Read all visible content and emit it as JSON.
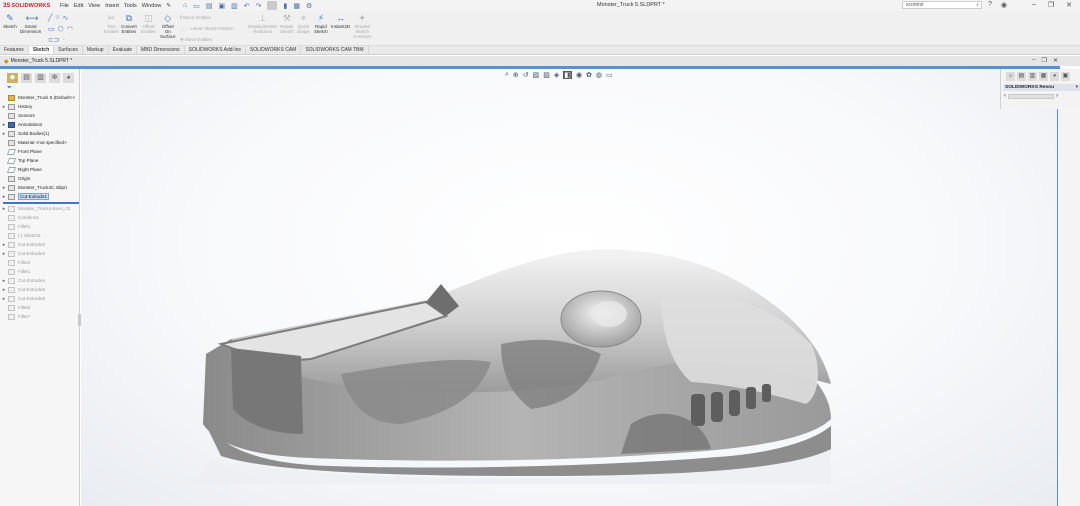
{
  "app": {
    "brand_ds": "3S",
    "brand_name": "SOLIDWORKS",
    "menus": [
      "File",
      "Edit",
      "View",
      "Insert",
      "Tools",
      "Window"
    ],
    "doc_title": "Monster_Truck 5.SLDPRT *",
    "search_placeholder": "xcontrol",
    "brand_color": "#d71920",
    "accent_color": "#5a8fd0"
  },
  "commands": {
    "sketch": "Sketch",
    "smart_dimension": [
      "Smart",
      "Dimension"
    ],
    "trim_entities": [
      "Trim",
      "Entities"
    ],
    "convert_entities": [
      "Convert",
      "Entities"
    ],
    "offset_entities": [
      "Offset",
      "Entities"
    ],
    "offset_on_surface": [
      "Offset",
      "On",
      "Surface"
    ],
    "mirror_entities": "Mirror Entities",
    "linear_sketch_pattern": "Linear Sketch Pattern",
    "move_entities": "Move Entities",
    "display_delete": [
      "Display/Delete",
      "Relations"
    ],
    "repair_sketch": [
      "Repair",
      "Sketch"
    ],
    "quick_snaps": [
      "Quick",
      "Snaps"
    ],
    "rapid_sketch": [
      "Rapid",
      "Sketch"
    ],
    "instant2d": "Instant2D",
    "shaded_sketch": [
      "Shaded",
      "Sketch",
      "Contours"
    ]
  },
  "tabs": [
    "Features",
    "Sketch",
    "Surfaces",
    "Markup",
    "Evaluate",
    "MBD Dimensions",
    "SOLIDWORKS Add-Ins",
    "SOLIDWORKS CAM",
    "SOLIDWORKS CAM TBM"
  ],
  "active_tab": "Sketch",
  "feature_tree": {
    "root": "Monster_Truck 5 (Default<<",
    "items": [
      {
        "label": "History",
        "expand": "▸",
        "kind": "folder"
      },
      {
        "label": "Sensors",
        "expand": "",
        "kind": "folder"
      },
      {
        "label": "Annotations",
        "expand": "▸",
        "kind": "ann"
      },
      {
        "label": "Solid Bodies(1)",
        "expand": "▸",
        "kind": "folder"
      },
      {
        "label": "Material <not specified>",
        "expand": "",
        "kind": "folder"
      },
      {
        "label": "Front Plane",
        "expand": "",
        "kind": "plane"
      },
      {
        "label": "Top Plane",
        "expand": "",
        "kind": "plane"
      },
      {
        "label": "Right Plane",
        "expand": "",
        "kind": "plane"
      },
      {
        "label": "Origin",
        "expand": "",
        "kind": "origin"
      },
      {
        "label": "Monster_Truck4C.sldprt",
        "expand": "▸",
        "kind": "folder"
      },
      {
        "label": "Cut-Extrude1",
        "expand": "▸",
        "kind": "sel"
      }
    ],
    "rolled_back": [
      {
        "label": "Monster_Truck4-Boss_Ot",
        "expand": "▸"
      },
      {
        "label": "Combine1",
        "expand": ""
      },
      {
        "label": "Fillet1",
        "expand": ""
      },
      {
        "label": "(-) Sketch3",
        "expand": ""
      },
      {
        "label": "Cut-Extrude2",
        "expand": "▸"
      },
      {
        "label": "Cut-Extrude3",
        "expand": "▸"
      },
      {
        "label": "Fillet4",
        "expand": ""
      },
      {
        "label": "Fillet1",
        "expand": ""
      },
      {
        "label": "Cut-Extrude4",
        "expand": "▸"
      },
      {
        "label": "Cut-Extrude5",
        "expand": "▸"
      },
      {
        "label": "Cut-Extrude6",
        "expand": "▸"
      },
      {
        "label": "Fillet5",
        "expand": ""
      },
      {
        "label": "Fillet7",
        "expand": ""
      }
    ]
  },
  "task_pane": {
    "title": "SOLIDWORKS Resou"
  }
}
